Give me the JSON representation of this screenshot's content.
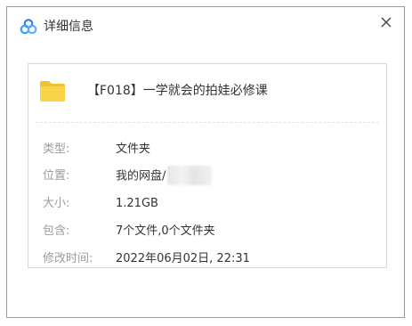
{
  "dialog": {
    "title": "详细信息",
    "icon": "baidu-netdisk-cloud-icon",
    "close_icon": "close-icon"
  },
  "file": {
    "icon": "folder-icon",
    "icon_color": "#f9d44b",
    "name": "【F018】一学就会的拍娃必修课"
  },
  "properties": [
    {
      "label": "类型:",
      "value": "文件夹"
    },
    {
      "label": "位置:",
      "value": "我的网盘/"
    },
    {
      "label": "大小:",
      "value": "1.21GB"
    },
    {
      "label": "包含:",
      "value": "7个文件,0个文件夹"
    },
    {
      "label": "修改时间:",
      "value": "2022年06月02日, 22:31"
    }
  ]
}
